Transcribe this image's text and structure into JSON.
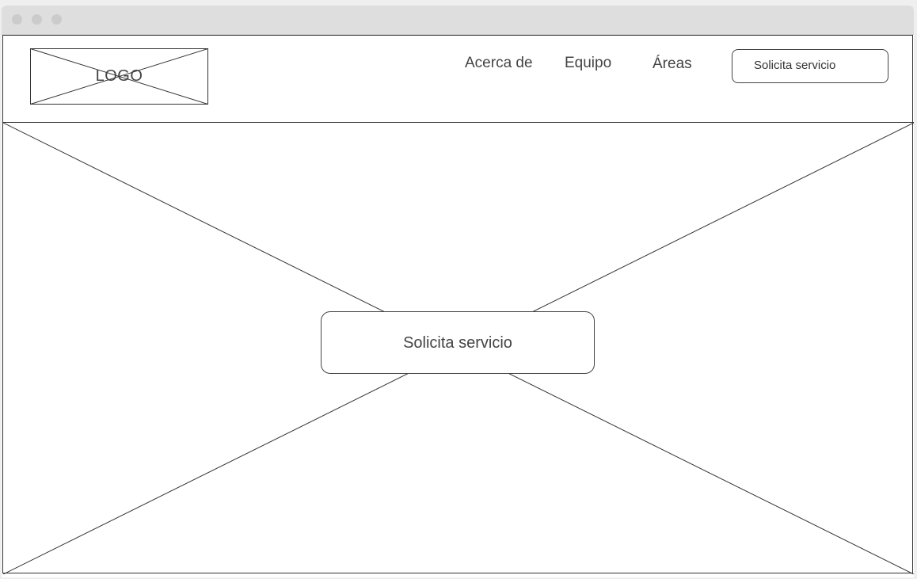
{
  "window": {
    "controls": [
      "close-dot",
      "minimize-dot",
      "maximize-dot"
    ]
  },
  "header": {
    "logo_label": "LOGO",
    "nav": {
      "about": "Acerca de",
      "team": "Equipo",
      "areas": "Áreas"
    },
    "cta_label": "Solicita servicio"
  },
  "hero": {
    "cta_label": "Solicita servicio"
  },
  "colors": {
    "background": "#efefef",
    "titlebar": "#dedede",
    "line": "#333333",
    "text": "#444444"
  }
}
